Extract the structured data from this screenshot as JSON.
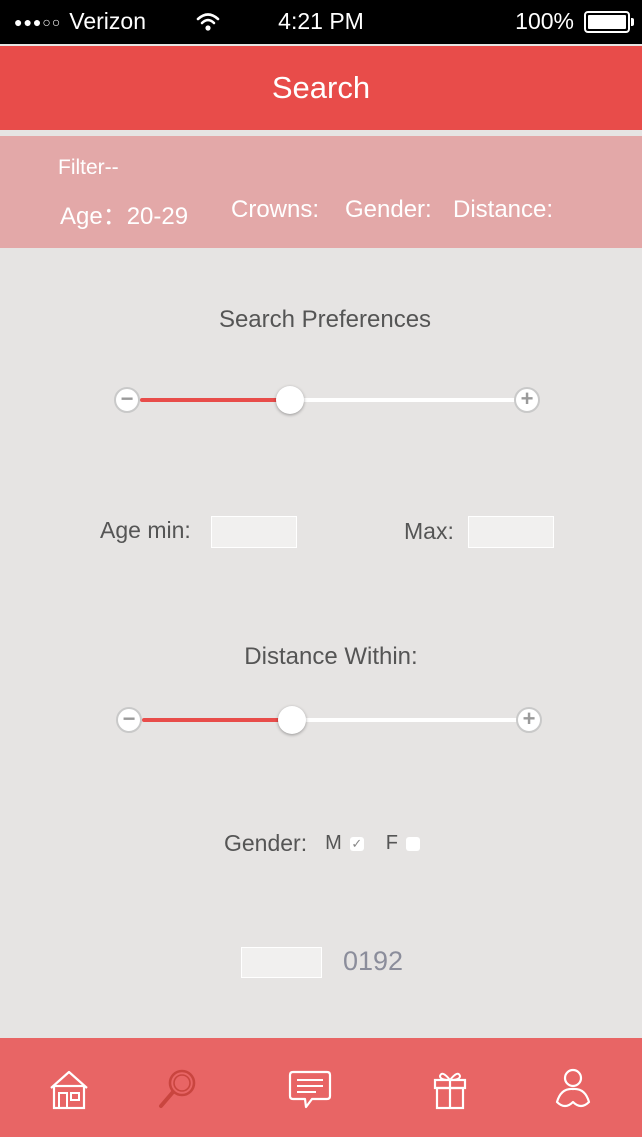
{
  "status_bar": {
    "carrier": "Verizon",
    "signal_dots": "●●●○○",
    "time": "4:21 PM",
    "battery": "100%"
  },
  "header": {
    "title": "Search"
  },
  "filter": {
    "label": "Filter--",
    "age": "Age：20-29",
    "crowns": "Crowns:",
    "gender": "Gender:",
    "distance": "Distance:"
  },
  "preferences": {
    "title": "Search Preferences",
    "slider_value": 0.4
  },
  "age": {
    "min_label": "Age min:",
    "min_value": "",
    "max_label": "Max:",
    "max_value": ""
  },
  "distance": {
    "title": "Distance Within:",
    "slider_value": 0.4
  },
  "gender": {
    "label": "Gender:",
    "male": "M",
    "female": "F",
    "male_checked": true,
    "female_checked": false,
    "check_glyph": "✓"
  },
  "code": {
    "input_value": "",
    "text": "0192"
  },
  "slider_buttons": {
    "minus": "−",
    "plus": "+"
  },
  "tabbar": {
    "items": [
      {
        "icon": "home-icon",
        "active": false
      },
      {
        "icon": "search-icon",
        "active": true
      },
      {
        "icon": "messages-icon",
        "active": false
      },
      {
        "icon": "gift-icon",
        "active": false
      },
      {
        "icon": "profile-icon",
        "active": false
      }
    ]
  },
  "colors": {
    "accent": "#e84c4a",
    "filter_bg": "#e3a8a8",
    "tabbar_bg": "#e86565",
    "page_bg": "#e6e4e3"
  }
}
